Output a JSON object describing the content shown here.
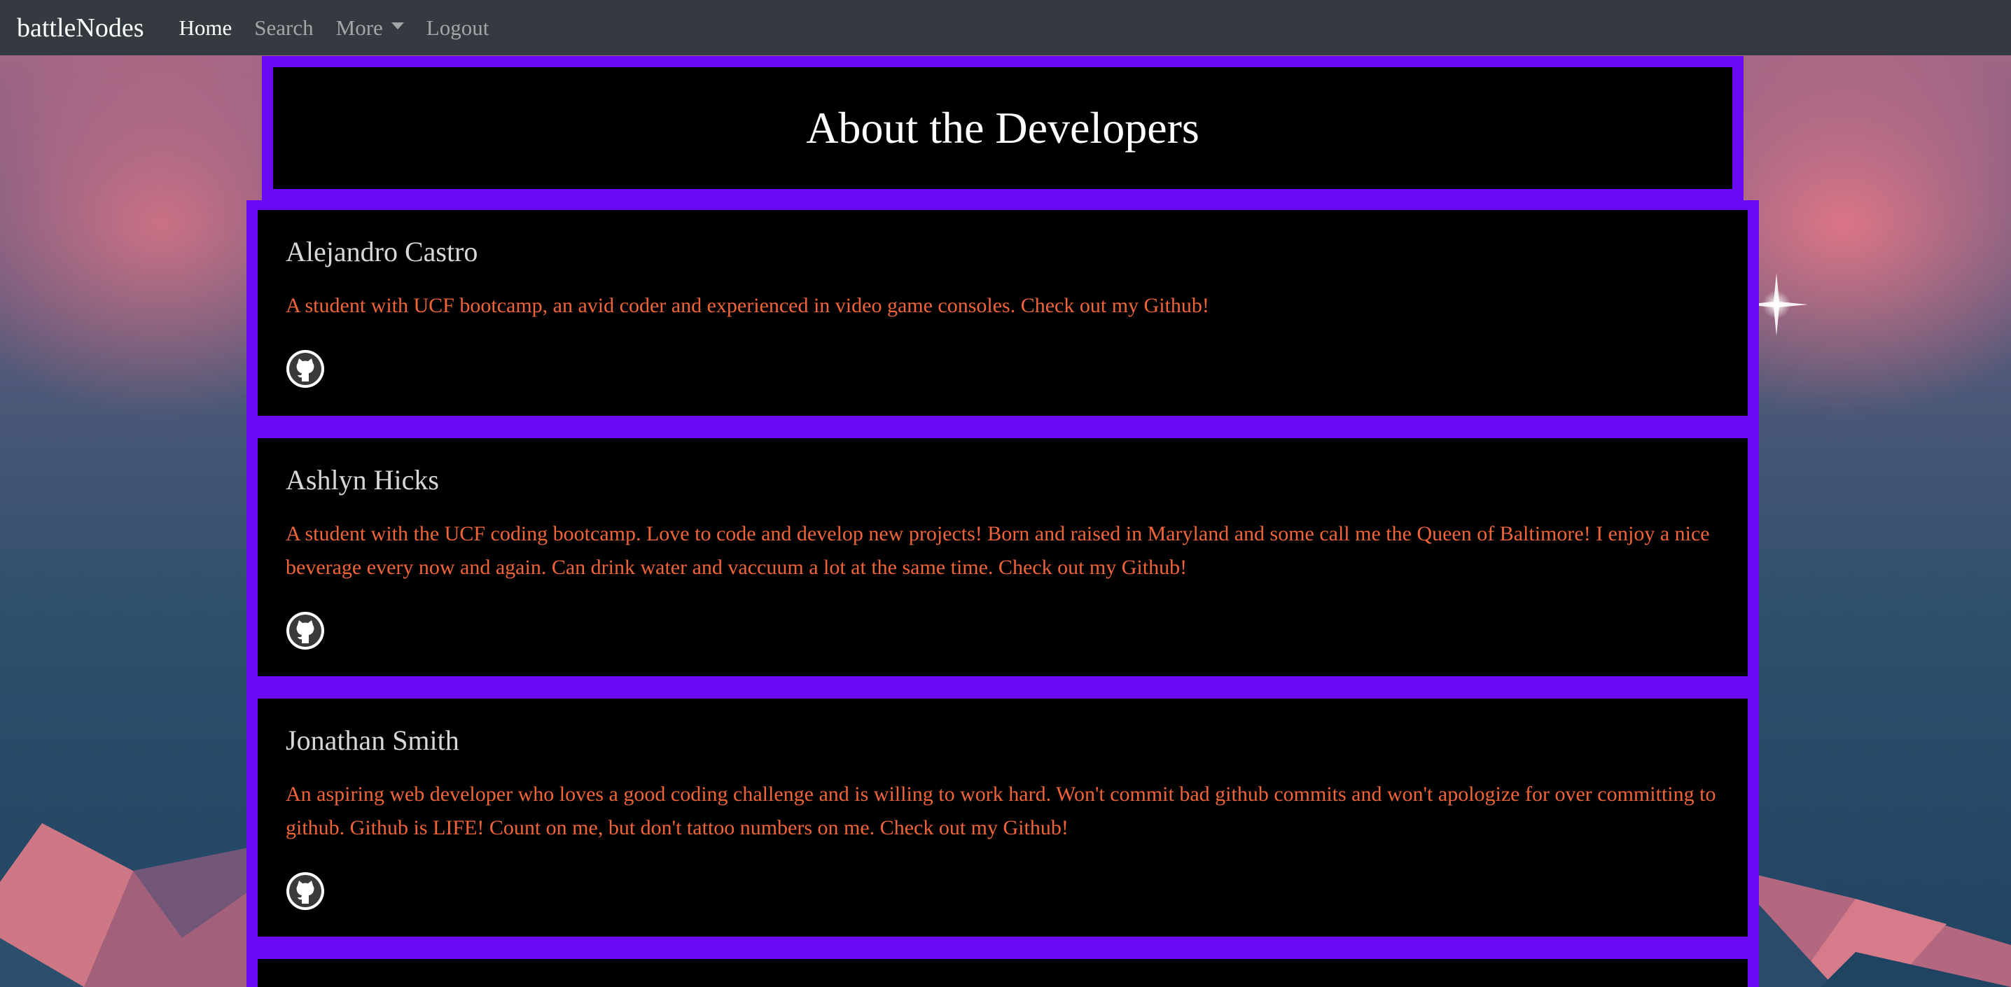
{
  "navbar": {
    "brand": "battleNodes",
    "items": [
      {
        "label": "Home",
        "active": true
      },
      {
        "label": "Search",
        "active": false
      },
      {
        "label": "More",
        "active": false,
        "dropdown": true
      },
      {
        "label": "Logout",
        "active": false
      }
    ]
  },
  "page": {
    "title": "About the Developers"
  },
  "developers": [
    {
      "name": "Alejandro Castro",
      "bio": "A student with UCF bootcamp, an avid coder and experienced in video game consoles. Check out my Github!",
      "icon": "github-icon"
    },
    {
      "name": "Ashlyn Hicks",
      "bio": "A student with the UCF coding bootcamp. Love to code and develop new projects! Born and raised in Maryland and some call me the Queen of Baltimore! I enjoy a nice beverage every now and again. Can drink water and vaccuum a lot at the same time. Check out my Github!",
      "icon": "github-icon"
    },
    {
      "name": "Jonathan Smith",
      "bio": "An aspiring web developer who loves a good coding challenge and is willing to work hard. Won't commit bad github commits and won't apologize for over committing to github. Github is LIFE! Count on me, but don't tattoo numbers on me. Check out my Github!",
      "icon": "github-icon"
    }
  ],
  "colors": {
    "navbar_bg": "#343a40",
    "frame_purple": "#6a0af5",
    "card_bg": "#000000",
    "name_text": "#d7d7d7",
    "bio_text": "#f0643a"
  }
}
